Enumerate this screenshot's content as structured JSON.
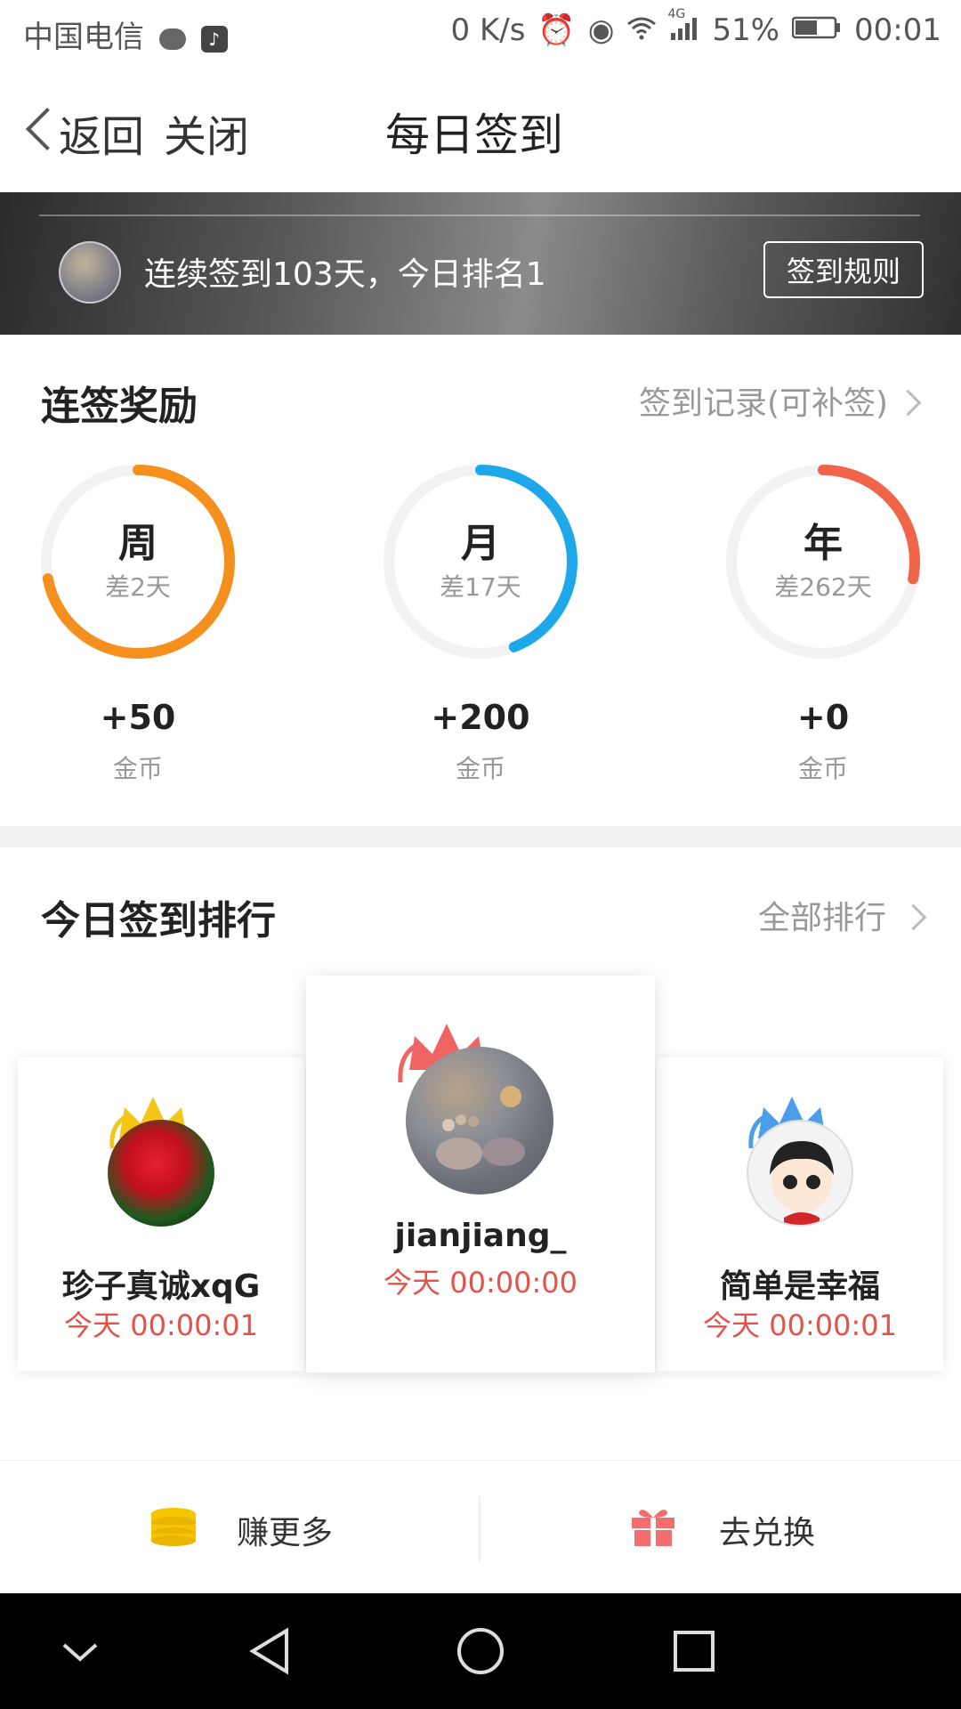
{
  "status_bar": {
    "carrier": "中国电信",
    "speed": "0 K/s",
    "network": "4G",
    "battery": "51%",
    "time": "00:01"
  },
  "nav": {
    "back_label": "返回",
    "close_label": "关闭",
    "title": "每日签到"
  },
  "banner": {
    "text": "连续签到103天，今日排名1",
    "rules_button": "签到规则"
  },
  "rewards": {
    "title": "连签奖励",
    "record_link": "签到记录(可补签)",
    "items": [
      {
        "label": "周",
        "remaining": "差2天",
        "coins": "+50",
        "unit": "金币",
        "progress": 0.72,
        "color": "#f5901e"
      },
      {
        "label": "月",
        "remaining": "差17天",
        "coins": "+200",
        "unit": "金币",
        "progress": 0.44,
        "color": "#1ea8ea"
      },
      {
        "label": "年",
        "remaining": "差262天",
        "coins": "+0",
        "unit": "金币",
        "progress": 0.28,
        "color": "#f06449"
      }
    ]
  },
  "ranking": {
    "title": "今日签到排行",
    "all_link": "全部排行",
    "entries": [
      {
        "rank": 2,
        "name": "珍子真诚xqG",
        "time": "今天 00:00:01",
        "crown_color": "#f5c518"
      },
      {
        "rank": 1,
        "name": "jianjiang_",
        "time": "今天 00:00:00",
        "crown_color": "#f06464"
      },
      {
        "rank": 3,
        "name": "简单是幸福",
        "time": "今天 00:00:01",
        "crown_color": "#4a9fe8"
      }
    ]
  },
  "actions": {
    "earn_label": "赚更多",
    "exchange_label": "去兑换"
  }
}
